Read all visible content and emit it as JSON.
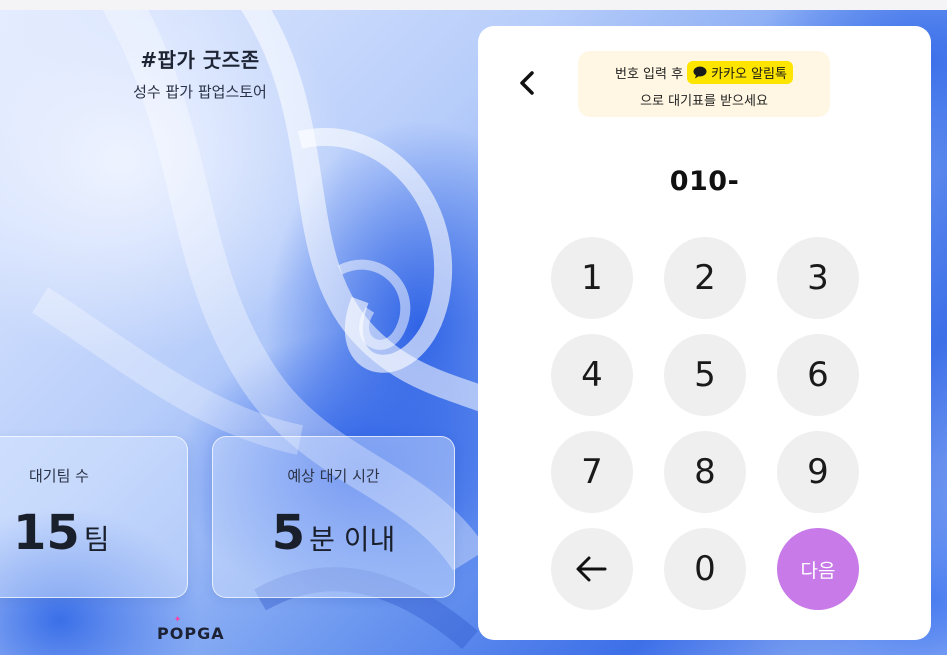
{
  "store": {
    "title": "#팝가 굿즈존",
    "subtitle": "성수 팝가 팝업스토어"
  },
  "stats": {
    "waiting_teams": {
      "label": "대기팀 수",
      "value": "15",
      "unit": "팀"
    },
    "wait_time": {
      "label": "예상 대기 시간",
      "value": "5",
      "unit": "분 이내"
    }
  },
  "brand": {
    "logo_start": "P",
    "logo_o": "O",
    "logo_end": "PGA"
  },
  "notice": {
    "prefix": "번호 입력 후",
    "kakao_label": "카카오 알림톡",
    "suffix": "으로 대기표를 받으세요"
  },
  "phone_input": {
    "value": "010-"
  },
  "keypad": {
    "k1": "1",
    "k2": "2",
    "k3": "3",
    "k4": "4",
    "k5": "5",
    "k6": "6",
    "k7": "7",
    "k8": "8",
    "k9": "9",
    "k0": "0",
    "next": "다음"
  },
  "icons": {
    "back": "chevron-left-icon",
    "backspace": "arrow-left-icon",
    "kakao": "chat-bubble-icon"
  },
  "colors": {
    "next_button": "#c77ae8",
    "kakao_badge": "#fee500",
    "notice_bg": "#fff7e3",
    "key_bg": "#efefef"
  }
}
